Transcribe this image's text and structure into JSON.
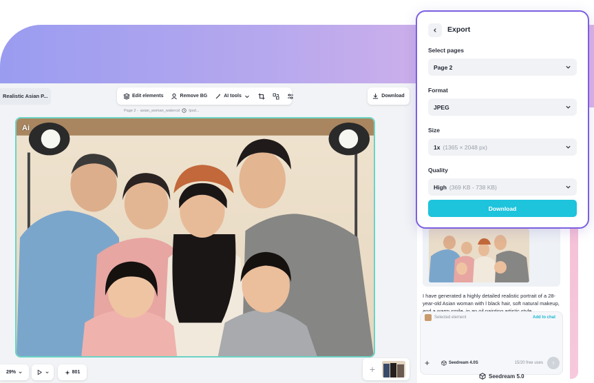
{
  "editor": {
    "design_name": "Realistic Asian P...",
    "toolbar": {
      "edit_elements": "Edit elements",
      "remove_bg": "Remove BG",
      "ai_tools": "AI tools"
    },
    "download_label": "Download",
    "page_label": "Page 2 -",
    "file_label": "asian_woman_watercol",
    "file_suffix": "Ipsd...",
    "ai_badge": "Ai",
    "zoom": "29%",
    "credits": "801"
  },
  "export": {
    "title": "Export",
    "select_pages_label": "Select pages",
    "select_pages_value": "Page 2",
    "format_label": "Format",
    "format_value": "JPEG",
    "size_label": "Size",
    "size_value": "1x",
    "size_detail": "(1365 × 2048 px)",
    "quality_label": "Quality",
    "quality_value": "High",
    "quality_detail": "(369 KB - 738 KB)",
    "download_button": "Download"
  },
  "chat": {
    "message": "I have generated a highly detailed realistic portrait of a 28-year-old Asian woman with l  black hair, soft natural makeup, and a warm smile, in an oil painting artistic style.",
    "selected_element": "Selected element",
    "add_to_chat": "Add to chat",
    "model": "Seedream 4.0S",
    "usage": "15/20 free uses",
    "footer_model": "Seedream 5.0"
  },
  "colors": {
    "accent": "#1ec3dc",
    "export_border": "#7b5fe0",
    "canvas_border": "#6bd3c4"
  }
}
